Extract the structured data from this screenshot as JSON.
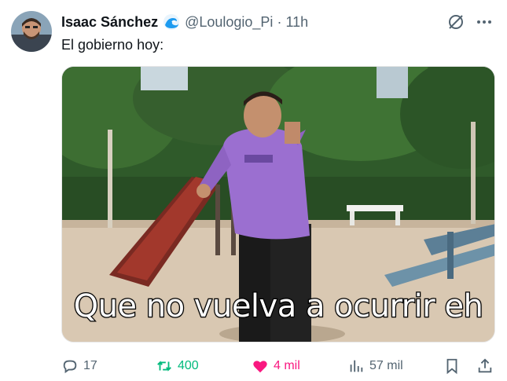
{
  "author": {
    "name": "Isaac Sánchez",
    "badge_icon": "wave-emoji-icon",
    "handle": "@Loulogio_Pi",
    "separator": "·",
    "time": "11h"
  },
  "tweet": {
    "text": "El gobierno hoy:"
  },
  "media": {
    "caption": "Que no vuelva a ocurrir eh"
  },
  "actions": {
    "replies": "17",
    "retweets": "400",
    "likes": "4 mil",
    "views": "57 mil"
  },
  "colors": {
    "retweet": "#00ba7c",
    "like": "#f91880",
    "muted": "#536471",
    "text": "#0f1419"
  }
}
